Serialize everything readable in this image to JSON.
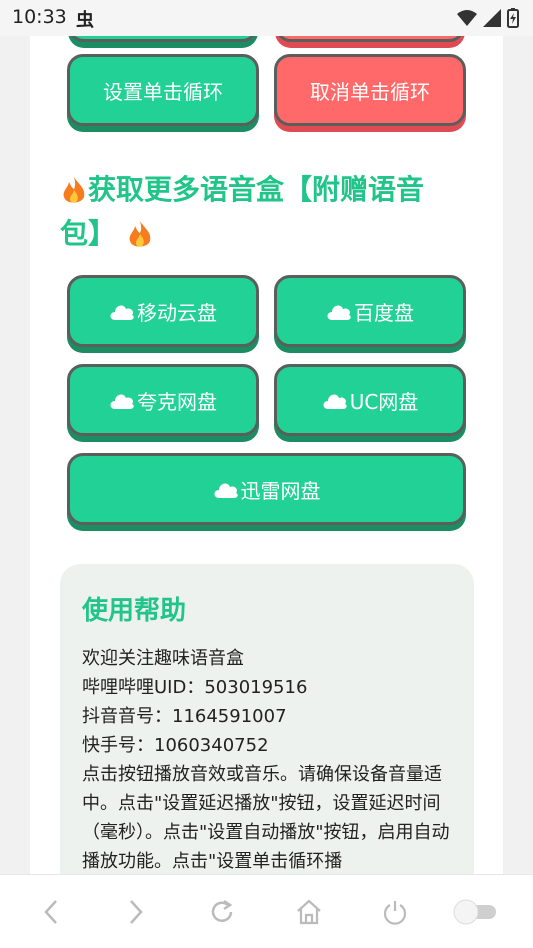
{
  "status_bar": {
    "time": "10:33",
    "bug_glyph": "虫"
  },
  "top_buttons": {
    "set_loop": "设置单击循环",
    "cancel_loop": "取消单击循环"
  },
  "section": {
    "title": "获取更多语音盒【附赠语音包】"
  },
  "cloud_buttons": [
    "移动云盘",
    "百度盘",
    "夸克网盘",
    "UC网盘",
    "迅雷网盘"
  ],
  "help": {
    "title": "使用帮助",
    "lines": [
      "欢迎关注趣味语音盒",
      "哔哩哔哩UID：503019516",
      "抖音音号：1164591007",
      "快手号：1060340752"
    ],
    "paragraph": "点击按钮播放音效或音乐。请确保设备音量适中。点击\"设置延迟播放\"按钮，设置延迟时间（毫秒）。点击\"设置自动播放\"按钮，启用自动播放功能。点击\"设置单击循环播"
  },
  "colors": {
    "accent": "#21d196",
    "danger": "#ff6969",
    "title": "#21c48a"
  }
}
